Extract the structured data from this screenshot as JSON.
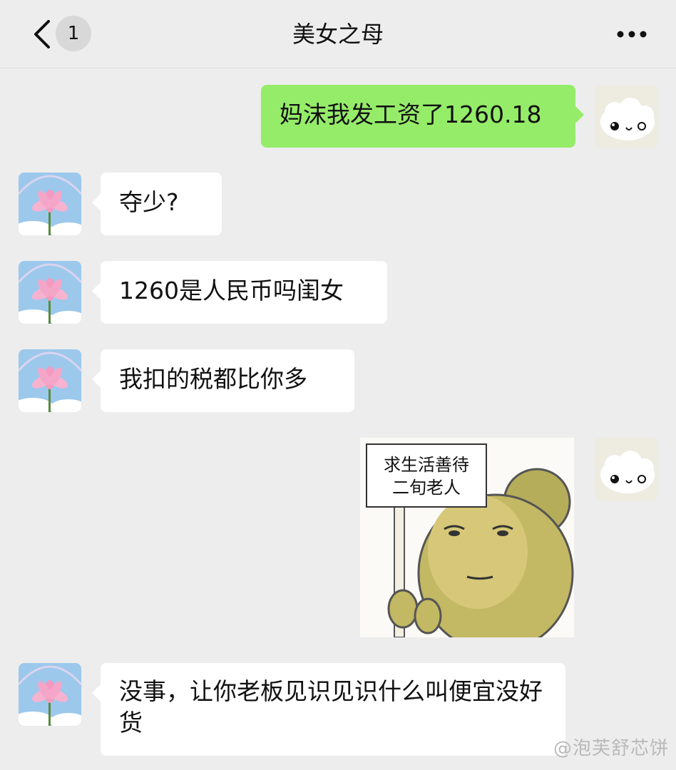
{
  "header": {
    "unread_count": "1",
    "title": "美女之母"
  },
  "messages": [
    {
      "side": "out",
      "type": "text",
      "text": "妈沫我发工资了1260.18"
    },
    {
      "side": "in",
      "type": "text",
      "text": "夺少?"
    },
    {
      "side": "in",
      "type": "text",
      "text": "1260是人民币吗闺女"
    },
    {
      "side": "in",
      "type": "text",
      "text": "我扣的税都比你多"
    },
    {
      "side": "out",
      "type": "sticker",
      "sign_line1": "求生活善待",
      "sign_line2": "二旬老人"
    },
    {
      "side": "in",
      "type": "text",
      "text": "没事，让你老板见识见识什么叫便宜没好货"
    }
  ],
  "watermark": "@泡芙舒芯饼",
  "colors": {
    "background": "#ededed",
    "outgoing_bubble": "#95ec69",
    "incoming_bubble": "#ffffff"
  },
  "icons": {
    "back": "chevron-left-icon",
    "more": "more-dots-icon",
    "contact_avatar": "lotus-avatar",
    "self_avatar": "sheep-avatar"
  }
}
